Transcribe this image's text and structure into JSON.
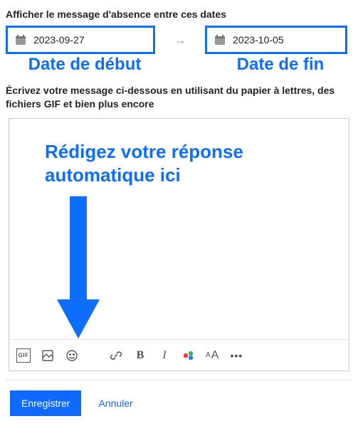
{
  "header": {
    "dates_label": "Afficher le message d'absence entre ces dates"
  },
  "dates": {
    "start": {
      "value": "2023-09-27",
      "caption": "Date de début"
    },
    "end": {
      "value": "2023-10-05",
      "caption": "Date de fin"
    },
    "arrow_glyph": "→"
  },
  "compose": {
    "description": "Écrivez votre message ci-dessous en utilisant du papier à lettres, des fichiers GIF et bien plus encore",
    "overlay_text": "Rédigez votre réponse automatique ici"
  },
  "toolbar": {
    "gif_label": "GIF",
    "bold_glyph": "B",
    "italic_glyph": "I",
    "textsize_small": "A",
    "textsize_large": "A",
    "more_glyph": "•••"
  },
  "footer": {
    "save_label": "Enregistrer",
    "cancel_label": "Annuler"
  },
  "colors": {
    "accent": "#0d6efd",
    "primary_button": "#0f69ff"
  }
}
